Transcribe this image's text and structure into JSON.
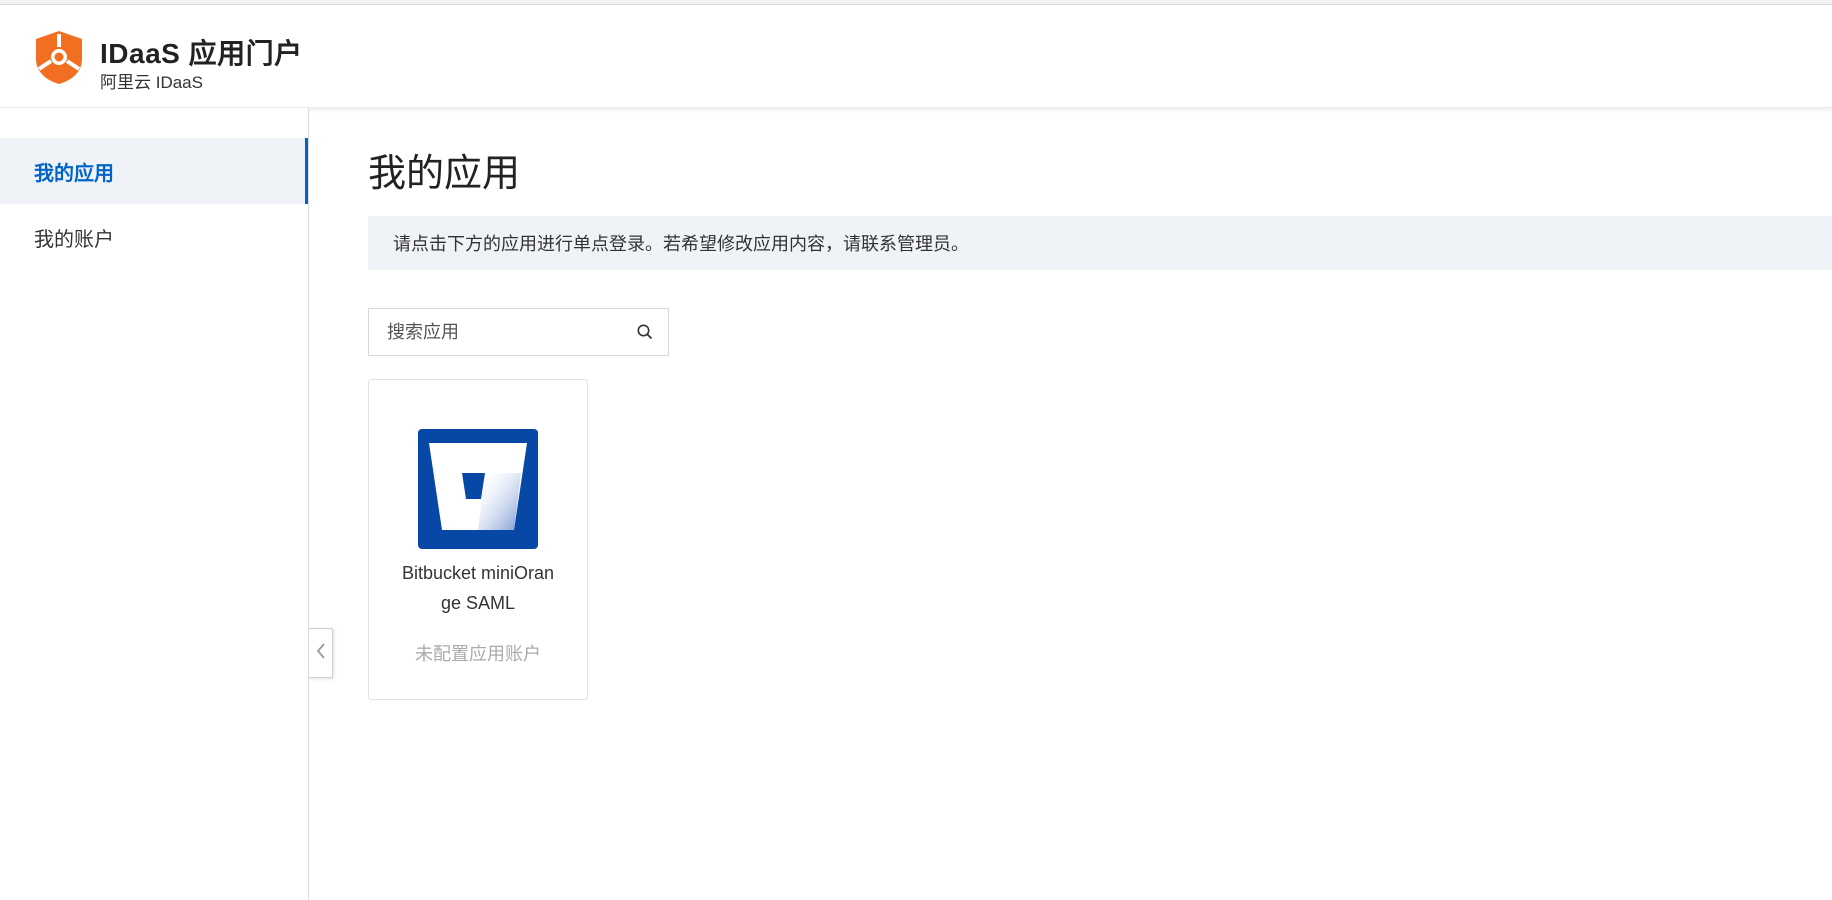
{
  "header": {
    "title": "IDaaS 应用门户",
    "subtitle": "阿里云 IDaaS",
    "logo_icon": "shield-logo-icon",
    "brand_color": "#f26f21"
  },
  "sidebar": {
    "items": [
      {
        "label": "我的应用",
        "active": true
      },
      {
        "label": "我的账户",
        "active": false
      }
    ],
    "collapse_icon": "chevron-left-icon"
  },
  "main": {
    "title": "我的应用",
    "notice": "请点击下方的应用进行单点登录。若希望修改应用内容，请联系管理员。",
    "search": {
      "placeholder": "搜索应用",
      "value": "",
      "icon": "search-icon"
    },
    "apps": [
      {
        "name": "Bitbucket miniOrange SAML",
        "status": "未配置应用账户",
        "icon": "bitbucket-icon",
        "icon_color": "#0747a6"
      }
    ]
  },
  "colors": {
    "accent": "#0064c8",
    "notice_bg": "#eff3f8",
    "muted_text": "#aaaaaa"
  }
}
